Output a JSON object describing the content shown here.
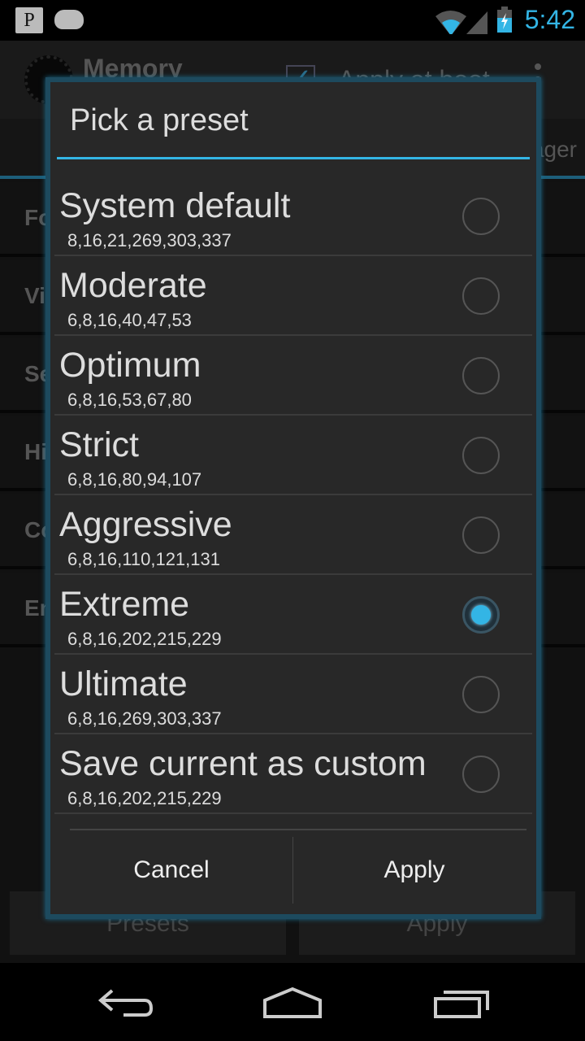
{
  "status_bar": {
    "time": "5:42",
    "time_color": "#33b5e5",
    "notification_icons": [
      "p-app-icon",
      "android-icon"
    ],
    "system_icons": [
      "wifi-icon",
      "signal-icon",
      "battery-charging-icon"
    ]
  },
  "background": {
    "title": "Memory",
    "apply_at_boot": "Apply at boot",
    "apply_at_boot_checked": true,
    "tab_partial": "ager",
    "rows": [
      "Fo",
      "Vi",
      "Se",
      "Hi",
      "Co",
      "En"
    ],
    "presets_button": "Presets",
    "apply_button": "Apply"
  },
  "dialog": {
    "title": "Pick a preset",
    "accent": "#33b5e5",
    "options": [
      {
        "name": "System default",
        "values": "8,16,21,269,303,337",
        "selected": false
      },
      {
        "name": "Moderate",
        "values": "6,8,16,40,47,53",
        "selected": false
      },
      {
        "name": "Optimum",
        "values": "6,8,16,53,67,80",
        "selected": false
      },
      {
        "name": "Strict",
        "values": "6,8,16,80,94,107",
        "selected": false
      },
      {
        "name": "Aggressive",
        "values": "6,8,16,110,121,131",
        "selected": false
      },
      {
        "name": "Extreme",
        "values": "6,8,16,202,215,229",
        "selected": true
      },
      {
        "name": "Ultimate",
        "values": "6,8,16,269,303,337",
        "selected": false
      },
      {
        "name": "Save current as custom",
        "values": "6,8,16,202,215,229",
        "selected": false
      }
    ],
    "cancel": "Cancel",
    "apply": "Apply"
  }
}
